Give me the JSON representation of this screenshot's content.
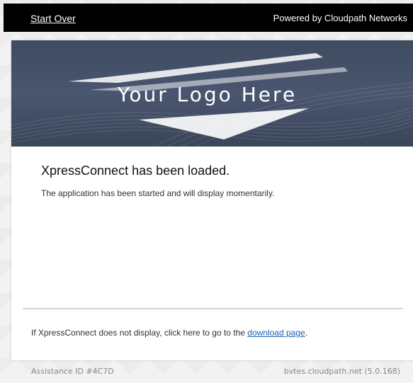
{
  "header": {
    "start_over_label": "Start Over",
    "powered_by": "Powered by Cloudpath Networks"
  },
  "banner": {
    "logo_text": "Your Logo Here"
  },
  "content": {
    "title": "XpressConnect has been loaded.",
    "subtitle": "The application has been started and will display momentarily.",
    "footer_prefix": "If XpressConnect does not display, click here to go to the ",
    "download_link": "download page",
    "footer_suffix": "."
  },
  "status": {
    "assistance_id": "Assistance ID #4C7D",
    "host_version": "bvtes.cloudpath.net (5.0.168)"
  },
  "colors": {
    "header_bg": "#000000",
    "banner_bg": "#45516a",
    "link": "#1a5fb4"
  }
}
